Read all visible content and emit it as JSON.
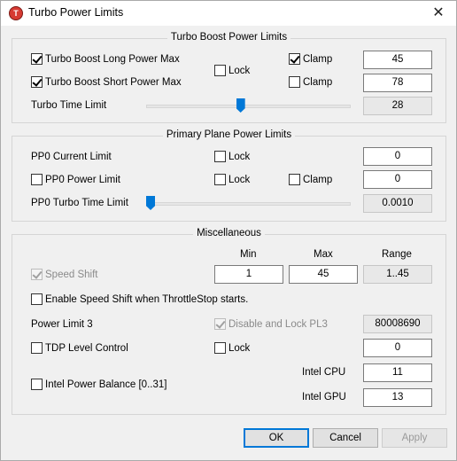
{
  "window": {
    "title": "Turbo Power Limits",
    "app_icon_letter": "T",
    "close_glyph": "✕"
  },
  "turbo": {
    "title": "Turbo Boost Power Limits",
    "long_label": "Turbo Boost Long Power Max",
    "long_checked": true,
    "short_label": "Turbo Boost Short Power Max",
    "short_checked": true,
    "lock_label": "Lock",
    "lock_checked": false,
    "clamp1_label": "Clamp",
    "clamp1_checked": true,
    "clamp2_label": "Clamp",
    "clamp2_checked": false,
    "long_value": "45",
    "short_value": "78",
    "time_label": "Turbo Time Limit",
    "time_value": "28",
    "time_slider_level": 0.46
  },
  "primary": {
    "title": "Primary Plane Power Limits",
    "current_label": "PP0 Current Limit",
    "lock1_label": "Lock",
    "lock1_checked": false,
    "current_value": "0",
    "power_label": "PP0 Power Limit",
    "power_checked": false,
    "lock2_label": "Lock",
    "lock2_checked": false,
    "clamp_label": "Clamp",
    "clamp_checked": false,
    "power_value": "0",
    "time_label": "PP0 Turbo Time Limit",
    "time_value": "0.0010",
    "time_slider_level": 0.0
  },
  "misc": {
    "title": "Miscellaneous",
    "col_min": "Min",
    "col_max": "Max",
    "col_range": "Range",
    "speedshift_label": "Speed Shift",
    "speedshift_checked": true,
    "min_value": "1",
    "max_value": "45",
    "range_value": "1..45",
    "enable_ss_label": "Enable Speed Shift when ThrottleStop starts.",
    "enable_ss_checked": false,
    "pl3_label": "Power Limit 3",
    "pl3_lock_label": "Disable and Lock PL3",
    "pl3_lock_checked": true,
    "pl3_value": "80008690",
    "tdp_label": "TDP Level Control",
    "tdp_checked": false,
    "tdp_lock_label": "Lock",
    "tdp_lock_checked": false,
    "tdp_value": "0",
    "cpu_label": "Intel CPU",
    "cpu_value": "11",
    "balance_label": "Intel Power Balance  [0..31]",
    "balance_checked": false,
    "gpu_label": "Intel GPU",
    "gpu_value": "13"
  },
  "buttons": {
    "ok": "OK",
    "cancel": "Cancel",
    "apply": "Apply"
  }
}
